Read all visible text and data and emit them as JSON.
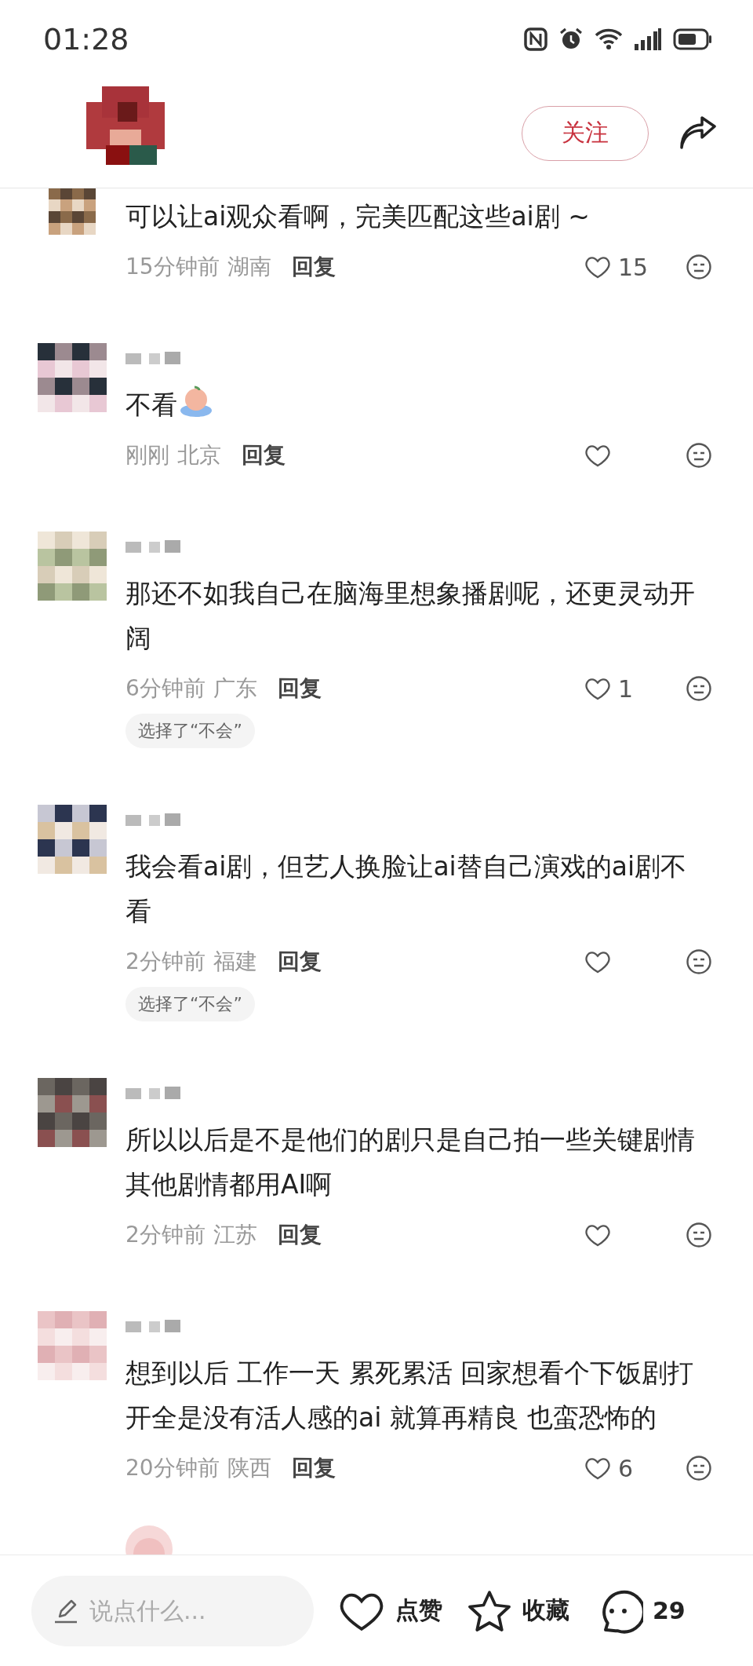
{
  "status_bar": {
    "time": "01:28"
  },
  "header": {
    "follow_button": "关注"
  },
  "comments": [
    {
      "text": "可以让ai观众看啊，完美匹配这些ai剧 ~",
      "has_sticker": false,
      "time": "15分钟前",
      "region": "湖南",
      "reply": "回复",
      "likes": "15",
      "liked": false
    },
    {
      "text": "不看",
      "has_sticker": true,
      "time": "刚刚",
      "region": "北京",
      "reply": "回复",
      "liked": false
    },
    {
      "text": "那还不如我自己在脑海里想象播剧呢，还更灵动开阔",
      "has_sticker": false,
      "time": "6分钟前",
      "region": "广东",
      "reply": "回复",
      "likes": "1",
      "liked": false,
      "vote": "选择了“不会”"
    },
    {
      "text": "我会看ai剧，但艺人换脸让ai替自己演戏的ai剧不看",
      "has_sticker": false,
      "time": "2分钟前",
      "region": "福建",
      "reply": "回复",
      "liked": false,
      "vote": "选择了“不会”"
    },
    {
      "text": "所以以后是不是他们的剧只是自己拍一些关键剧情其他剧情都用AI啊",
      "has_sticker": false,
      "time": "2分钟前",
      "region": "江苏",
      "reply": "回复",
      "liked": false
    },
    {
      "text": "想到以后 工作一天 累死累活 回家想看个下饭剧打开全是没有活人感的ai 就算再精良 也蛮恐怖的",
      "has_sticker": false,
      "time": "20分钟前",
      "region": "陕西",
      "reply": "回复",
      "likes": "6",
      "liked": false
    }
  ],
  "bottom_bar": {
    "placeholder": "说点什么...",
    "like_label": "点赞",
    "favorite_label": "收藏",
    "comment_count": "29"
  }
}
